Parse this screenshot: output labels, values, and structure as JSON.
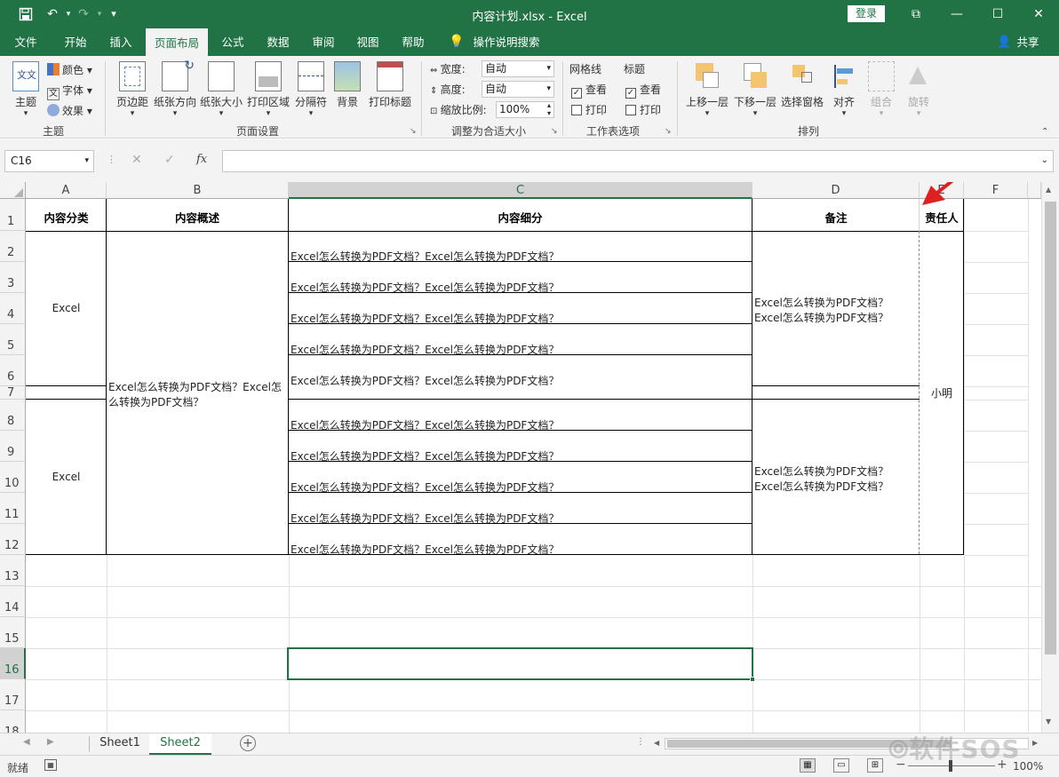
{
  "window": {
    "title": "内容计划.xlsx  -  Excel",
    "login_label": "登录",
    "minimize": "—",
    "restore": "☐",
    "close": "✕",
    "ribbon_display": "⧉"
  },
  "qat": {
    "save": "💾",
    "undo": "↶",
    "redo": "↷",
    "customize": "▾"
  },
  "tabs": [
    {
      "label": "文件"
    },
    {
      "label": "开始"
    },
    {
      "label": "插入"
    },
    {
      "label": "页面布局"
    },
    {
      "label": "公式"
    },
    {
      "label": "数据"
    },
    {
      "label": "审阅"
    },
    {
      "label": "视图"
    },
    {
      "label": "帮助"
    },
    {
      "label": "操作说明搜索"
    }
  ],
  "share_label": "共享",
  "ribbon": {
    "theme": {
      "big_label": "主题",
      "colors": "颜色",
      "fonts": "字体",
      "effects": "效果",
      "group": "主题"
    },
    "page_setup": {
      "margins": "页边距",
      "orientation": "纸张方向",
      "size": "纸张大小",
      "print_area": "打印区域",
      "breaks": "分隔符",
      "background": "背景",
      "print_titles": "打印标题",
      "group": "页面设置"
    },
    "scale": {
      "width_label": "宽度:",
      "width_value": "自动",
      "height_label": "高度:",
      "height_value": "自动",
      "scale_label": "缩放比例:",
      "scale_value": "100%",
      "group": "调整为合适大小"
    },
    "sheet_options": {
      "gridlines": "网格线",
      "headings": "标题",
      "view": "查看",
      "print": "打印",
      "group": "工作表选项"
    },
    "arrange": {
      "bring_forward": "上移一层",
      "send_backward": "下移一层",
      "selection_pane": "选择窗格",
      "align": "对齐",
      "group_btn": "组合",
      "rotate": "旋转",
      "group": "排列"
    }
  },
  "formula_bar": {
    "name_box": "C16",
    "cancel": "✕",
    "enter": "✓",
    "fx": "fx",
    "content": ""
  },
  "columns": [
    "A",
    "B",
    "C",
    "D",
    "E",
    "F"
  ],
  "rows": [
    "1",
    "2",
    "3",
    "4",
    "5",
    "6",
    "7",
    "8",
    "9",
    "10",
    "11",
    "12",
    "13",
    "14",
    "15",
    "16",
    "17",
    "18"
  ],
  "sheet": {
    "headers": {
      "a": "内容分类",
      "b": "内容概述",
      "c": "内容细分",
      "d": "备注",
      "e": "责任人"
    },
    "a_top": "Excel",
    "a_bottom": "Excel",
    "b_merged_line1": "Excel怎么转换为PDF文档？Excel怎",
    "b_merged_line2": "么转换为PDF文档？",
    "c_rows": [
      "Excel怎么转换为PDF文档？Excel怎么转换为PDF文档？",
      "Excel怎么转换为PDF文档？Excel怎么转换为PDF文档？",
      "Excel怎么转换为PDF文档？Excel怎么转换为PDF文档？",
      "Excel怎么转换为PDF文档？Excel怎么转换为PDF文档？",
      "Excel怎么转换为PDF文档？Excel怎么转换为PDF文档？",
      "Excel怎么转换为PDF文档？Excel怎么转换为PDF文档？",
      "Excel怎么转换为PDF文档？Excel怎么转换为PDF文档？",
      "Excel怎么转换为PDF文档？Excel怎么转换为PDF文档？",
      "Excel怎么转换为PDF文档？Excel怎么转换为PDF文档？",
      "Excel怎么转换为PDF文档？Excel怎么转换为PDF文档？"
    ],
    "d_top_1": "Excel怎么转换为PDF文档？",
    "d_top_2": "Excel怎么转换为PDF文档？",
    "d_bottom_1": "Excel怎么转换为PDF文档？",
    "d_bottom_2": "Excel怎么转换为PDF文档？",
    "e_merged": "小明"
  },
  "sheet_tabs": [
    {
      "label": "Sheet1"
    },
    {
      "label": "Sheet2"
    }
  ],
  "status": {
    "ready": "就绪",
    "zoom": "100%"
  },
  "watermark": "软件SOS",
  "accent_color": "#217346"
}
